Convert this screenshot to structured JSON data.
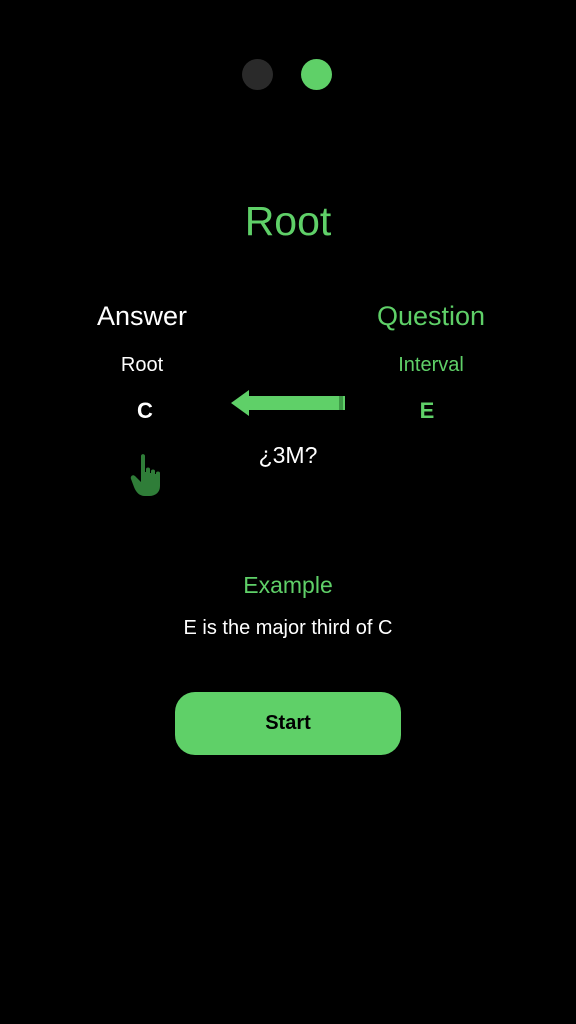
{
  "pager": {
    "pages": 2,
    "current": 2
  },
  "title": "Root",
  "answer": {
    "heading": "Answer",
    "sub": "Root",
    "note": "C"
  },
  "question": {
    "heading": "Question",
    "sub": "Interval",
    "note": "E"
  },
  "hint": "¿3M?",
  "example": {
    "heading": "Example",
    "text": "E is the major third of C"
  },
  "start_label": "Start",
  "icons": {
    "arrow": "arrow-left-icon",
    "hand": "pointing-hand-icon"
  },
  "colors": {
    "background": "#000000",
    "accent": "#5fd068",
    "inactive_dot": "#2a2a2a",
    "hand": "#2f7d38",
    "text": "#ffffff"
  }
}
